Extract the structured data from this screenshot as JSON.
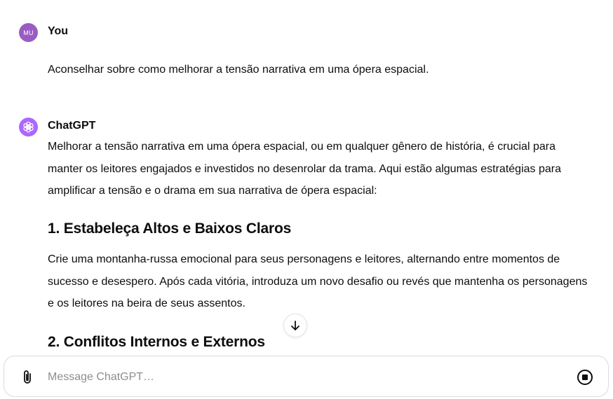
{
  "user_turn": {
    "avatar_initials": "MU",
    "author": "You",
    "message": "Aconselhar sobre como melhorar a tensão narrativa em uma ópera espacial."
  },
  "assistant_turn": {
    "author": "ChatGPT",
    "intro": "Melhorar a tensão narrativa em uma ópera espacial, ou em qualquer gênero de história, é crucial para manter os leitores engajados e investidos no desenrolar da trama. Aqui estão algumas estratégias para amplificar a tensão e o drama em sua narrativa de ópera espacial:",
    "sections": [
      {
        "heading": "1. Estabeleça Altos e Baixos Claros",
        "body": "Crie uma montanha-russa emocional para seus personagens e leitores, alternando entre momentos de sucesso e desespero. Após cada vitória, introduza um novo desafio ou revés que mantenha os personagens e os leitores na beira de seus assentos."
      },
      {
        "heading": "2. Conflitos Internos e Externos"
      }
    ]
  },
  "composer": {
    "placeholder": "Message ChatGPT…"
  },
  "icons": {
    "attach": "paperclip-icon",
    "stop": "stop-icon",
    "scroll": "arrow-down-icon",
    "assistant_logo": "openai-logo-icon"
  },
  "colors": {
    "user_avatar": "#9a5cc4",
    "assistant_avatar": "#ab68ff",
    "text": "#0d0d0d",
    "placeholder": "#8e8e8e"
  }
}
